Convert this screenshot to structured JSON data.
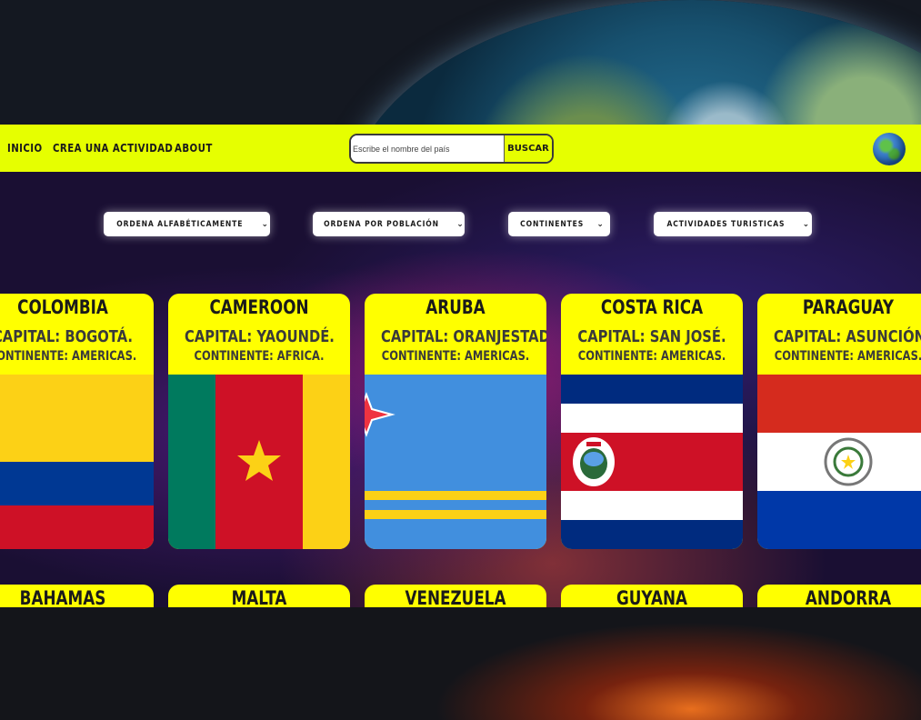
{
  "nav": {
    "links": [
      "INICIO",
      "CREA UNA ACTIVIDAD",
      "ABOUT"
    ]
  },
  "search": {
    "placeholder": "Escribe el nombre del país",
    "button_label": "BUSCAR"
  },
  "filters": [
    "ORDENA ALFABÉTICAMENTE",
    "ORDENA POR POBLACIÓN",
    "CONTINENTES",
    "ACTIVIDADES TURISTICAS"
  ],
  "countries_row1": [
    {
      "name": "COLOMBIA",
      "capital": "CAPITAL: BOGOTÁ.",
      "continent": "CONTINENTE: AMERICAS.",
      "flag_icon": "colombia-flag"
    },
    {
      "name": "CAMEROON",
      "capital": "CAPITAL: YAOUNDÉ.",
      "continent": "CONTINENTE: AFRICA.",
      "flag_icon": "cameroon-flag"
    },
    {
      "name": "ARUBA",
      "capital": "CAPITAL: ORANJESTAD.",
      "continent": "CONTINENTE: AMERICAS.",
      "flag_icon": "aruba-flag"
    },
    {
      "name": "COSTA RICA",
      "capital": "CAPITAL: SAN JOSÉ.",
      "continent": "CONTINENTE: AMERICAS.",
      "flag_icon": "costa-rica-flag"
    },
    {
      "name": "PARAGUAY",
      "capital": "CAPITAL: ASUNCIÓN.",
      "continent": "CONTINENTE: AMERICAS.",
      "flag_icon": "paraguay-flag"
    }
  ],
  "countries_row2": [
    "BAHAMAS",
    "MALTA",
    "VENEZUELA",
    "GUYANA",
    "ANDORRA"
  ],
  "colors": {
    "navbar": "#e6ff00",
    "card": "#ffff00",
    "text": "#1a1a1a"
  }
}
